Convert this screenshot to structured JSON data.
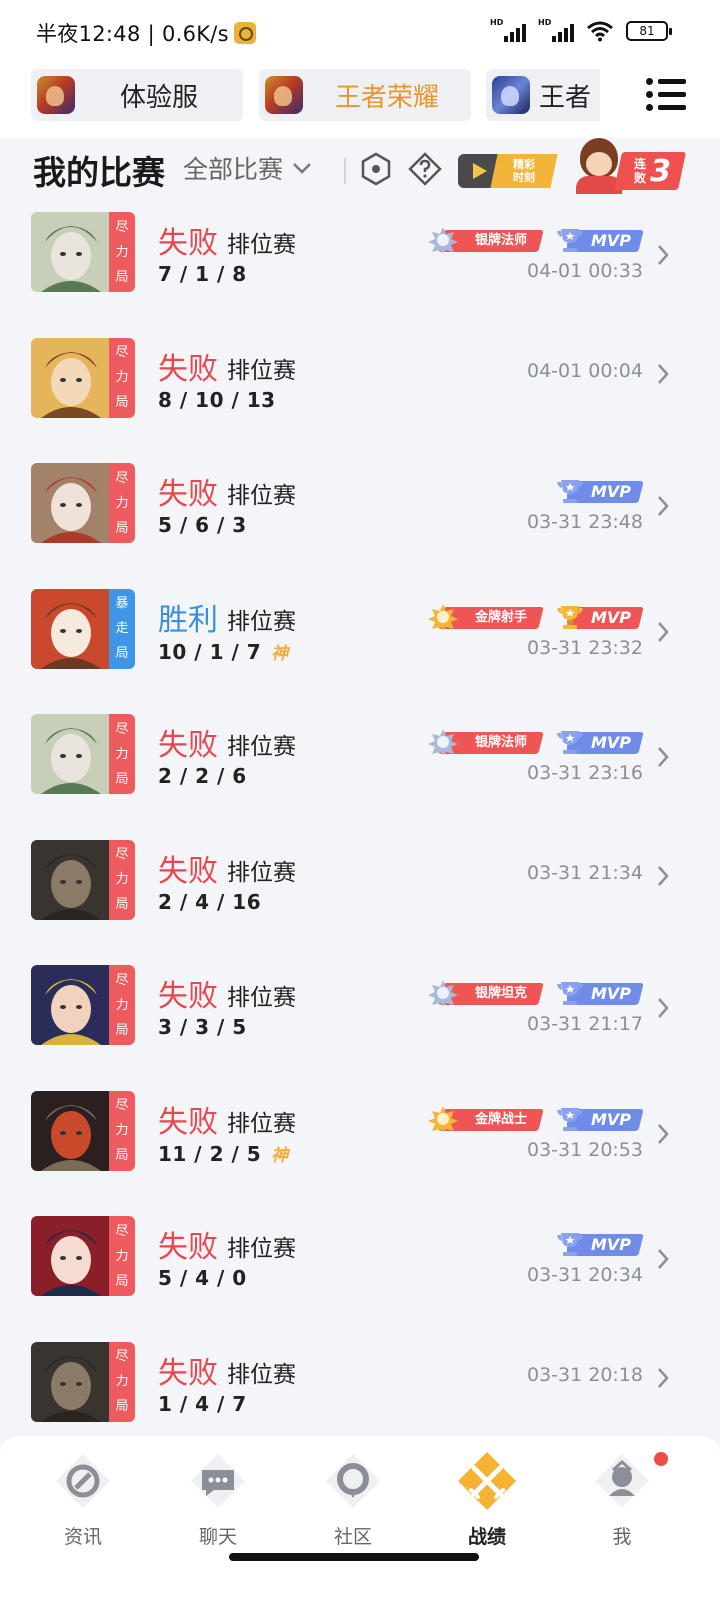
{
  "status_bar": {
    "time": "半夜12:48 | 0.6K/s",
    "signal1_label": "HD",
    "signal2_label": "HD",
    "battery": "81"
  },
  "app_tabs": [
    {
      "label": "体验服",
      "icon": "game-icon",
      "active": false
    },
    {
      "label": "王者荣耀",
      "icon": "game-icon",
      "active": true
    },
    {
      "label": "王者",
      "icon": "game-icon-blue",
      "active": false
    }
  ],
  "header": {
    "title": "我的比赛",
    "filter_label": "全部比赛",
    "highlight_label": "精彩时刻",
    "streak_label": "连败",
    "streak_count": "3"
  },
  "colors": {
    "lose": "#e9474d",
    "win": "#3a8fde",
    "accent": "#e8962b"
  },
  "matches": [
    {
      "result": "失败",
      "type": "排位赛",
      "kda": "7 / 1 / 8",
      "time": "04-01 00:33",
      "mode": [
        "尽",
        "力",
        "局"
      ],
      "rank_badge": "银牌法师",
      "mvp": "MVP",
      "mvp_color": "silver",
      "hero": "hero-white-hair"
    },
    {
      "result": "失败",
      "type": "排位赛",
      "kda": "8 / 10 / 13",
      "time": "04-01 00:04",
      "mode": [
        "尽",
        "力",
        "局"
      ],
      "hero": "hero-blonde"
    },
    {
      "result": "失败",
      "type": "排位赛",
      "kda": "5 / 6 / 3",
      "time": "03-31 23:48",
      "mode": [
        "尽",
        "力",
        "局"
      ],
      "mvp": "MVP",
      "mvp_color": "silver",
      "hero": "hero-old-warrior"
    },
    {
      "result": "胜利",
      "type": "排位赛",
      "kda": "10 / 1 / 7",
      "god": "神",
      "time": "03-31 23:32",
      "mode": [
        "暴",
        "走",
        "局"
      ],
      "rank_badge": "金牌射手",
      "mvp": "MVP",
      "mvp_color": "gold",
      "hero": "hero-doll"
    },
    {
      "result": "失败",
      "type": "排位赛",
      "kda": "2 / 2 / 6",
      "time": "03-31 23:16",
      "mode": [
        "尽",
        "力",
        "局"
      ],
      "rank_badge": "银牌法师",
      "mvp": "MVP",
      "mvp_color": "silver",
      "hero": "hero-white-hair"
    },
    {
      "result": "失败",
      "type": "排位赛",
      "kda": "2 / 4 / 16",
      "time": "03-31 21:34",
      "mode": [
        "尽",
        "力",
        "局"
      ],
      "hero": "hero-beast"
    },
    {
      "result": "失败",
      "type": "排位赛",
      "kda": "3 / 3 / 5",
      "time": "03-31 21:17",
      "mode": [
        "尽",
        "力",
        "局"
      ],
      "rank_badge": "银牌坦克",
      "mvp": "MVP",
      "mvp_color": "silver",
      "hero": "hero-dark-hair"
    },
    {
      "result": "失败",
      "type": "排位赛",
      "kda": "11 / 2 / 5",
      "god": "神",
      "time": "03-31 20:53",
      "mode": [
        "尽",
        "力",
        "局"
      ],
      "rank_badge": "金牌战士",
      "mvp": "MVP",
      "mvp_color": "silver",
      "hero": "hero-red-warrior"
    },
    {
      "result": "失败",
      "type": "排位赛",
      "kda": "5 / 4 / 0",
      "time": "03-31 20:34",
      "mode": [
        "尽",
        "力",
        "局"
      ],
      "mvp": "MVP",
      "mvp_color": "silver",
      "hero": "hero-girl"
    },
    {
      "result": "失败",
      "type": "排位赛",
      "kda": "1 / 4 / 7",
      "time": "03-31 20:18",
      "mode": [
        "尽",
        "力",
        "局"
      ],
      "hero": "hero-beast"
    }
  ],
  "bottom_nav": [
    {
      "label": "资讯",
      "icon": "news-icon",
      "active": false
    },
    {
      "label": "聊天",
      "icon": "chat-icon",
      "active": false
    },
    {
      "label": "社区",
      "icon": "community-icon",
      "active": false
    },
    {
      "label": "战绩",
      "icon": "record-icon",
      "active": true
    },
    {
      "label": "我",
      "icon": "profile-icon",
      "active": false
    }
  ]
}
